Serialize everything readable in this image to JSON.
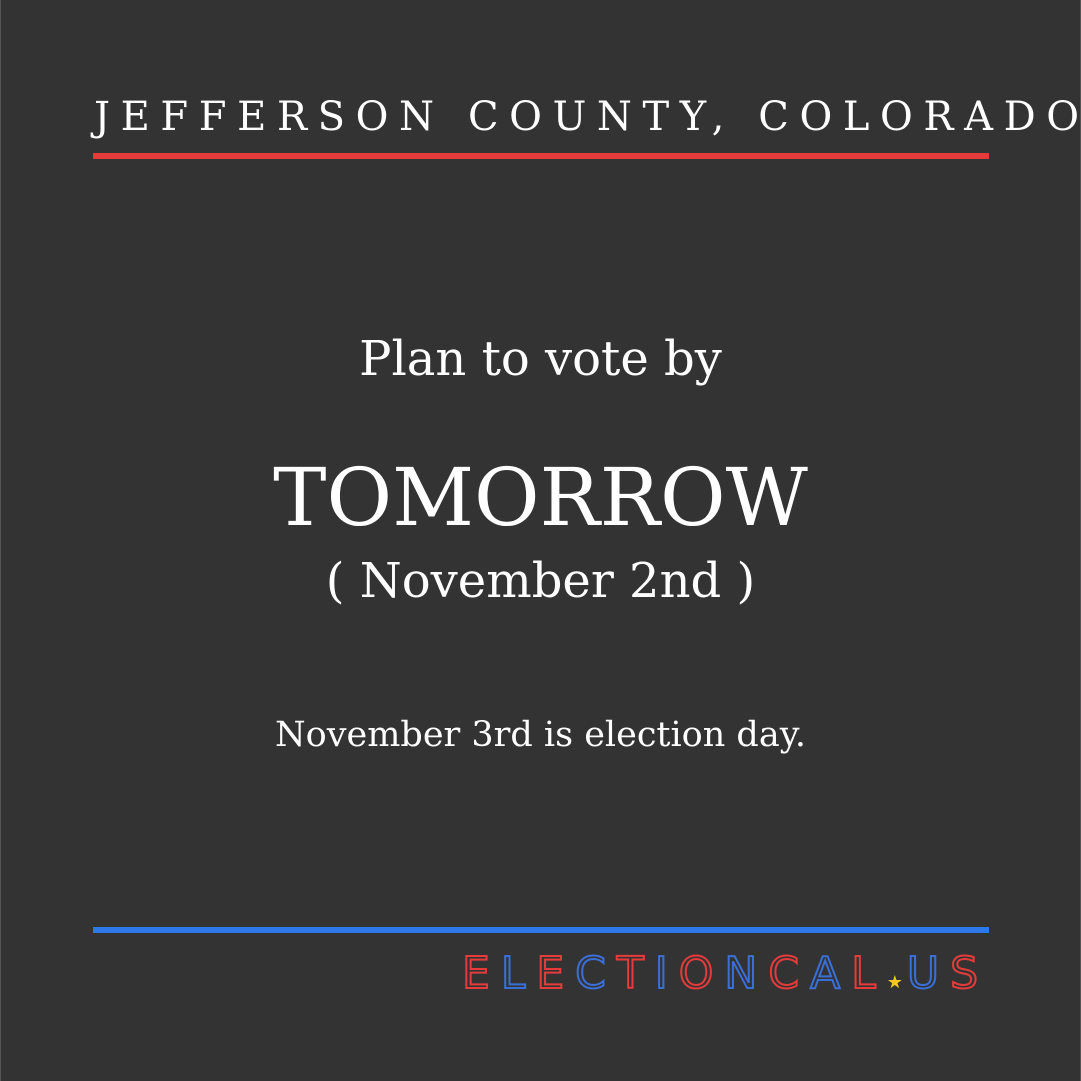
{
  "header": {
    "county": "JEFFERSON COUNTY, COLORADO"
  },
  "message": {
    "lead": "Plan to vote by",
    "deadline": "TOMORROW",
    "date": "( November 2nd )",
    "election_note": "November 3rd is election day."
  },
  "logo": {
    "text": "ELECTIONCAL.US",
    "part_main": [
      "E",
      "L",
      "E",
      "C",
      "T",
      "I",
      "O",
      "N",
      "C",
      "A",
      "L"
    ],
    "part_tld": [
      "U",
      "S"
    ],
    "separator_icon": "star-icon"
  },
  "colors": {
    "background": "#333333",
    "text": "#ffffff",
    "accent_red": "#e53b3b",
    "accent_blue": "#2f78e8",
    "star": "#f2c71e"
  }
}
